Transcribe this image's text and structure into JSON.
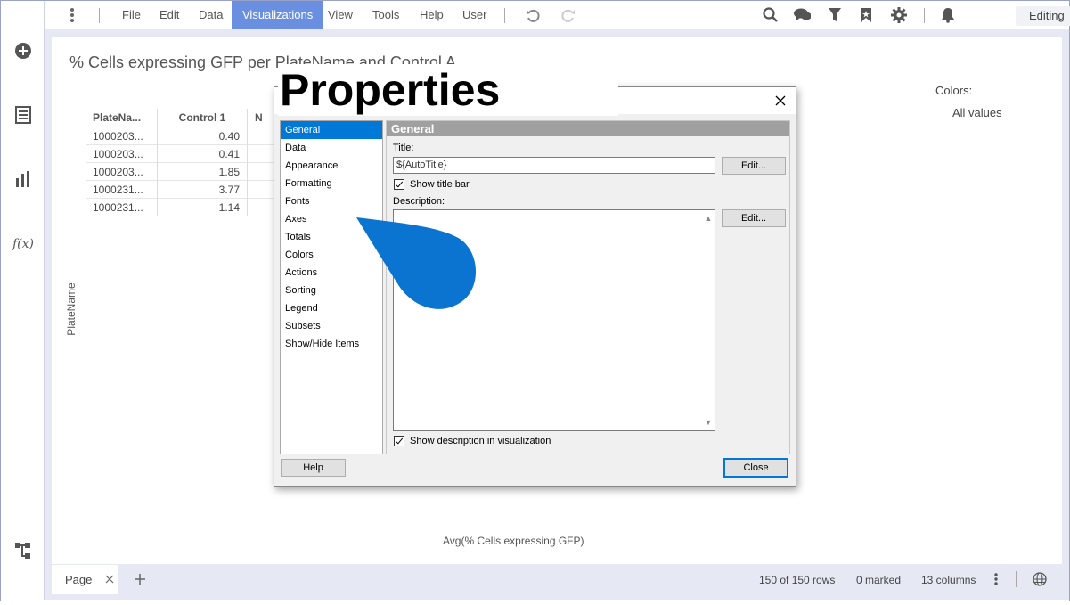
{
  "menu": {
    "items": [
      "File",
      "Edit",
      "Data",
      "Visualizations",
      "View",
      "Tools",
      "Help",
      "User"
    ],
    "active": "Visualizations",
    "mode": "Editing"
  },
  "viz": {
    "title": "% Cells expressing GFP per PlateName and Control A",
    "colors_label": "Colors:",
    "colors_value": "All values",
    "y_axis_label": "PlateName",
    "x_axis_label": "Avg(% Cells expressing GFP)",
    "table": {
      "headers": [
        "PlateNa...",
        "Control 1",
        "N"
      ],
      "rows": [
        [
          "1000203...",
          "0.40"
        ],
        [
          "1000203...",
          "0.41"
        ],
        [
          "1000203...",
          "1.85"
        ],
        [
          "1000231...",
          "3.77"
        ],
        [
          "1000231...",
          "1.14"
        ]
      ]
    }
  },
  "dialog": {
    "title": "Properties",
    "nav": [
      "General",
      "Data",
      "Appearance",
      "Formatting",
      "Fonts",
      "Axes",
      "Totals",
      "Colors",
      "Actions",
      "Sorting",
      "Legend",
      "Subsets",
      "Show/Hide Items"
    ],
    "selected": "General",
    "panel_title": "General",
    "title_label": "Title:",
    "title_value": "${AutoTitle}",
    "edit_label": "Edit...",
    "show_title_bar": "Show title bar",
    "description_label": "Description:",
    "show_description": "Show description in visualization",
    "help_label": "Help",
    "close_label": "Close"
  },
  "bottom": {
    "page_tab": "Page",
    "rows": "150 of 150 rows",
    "marked": "0 marked",
    "columns": "13 columns"
  },
  "colors": {
    "accent": "#6b8fe0",
    "selection": "#0078d7",
    "drop_shape": "#0a74d0"
  }
}
